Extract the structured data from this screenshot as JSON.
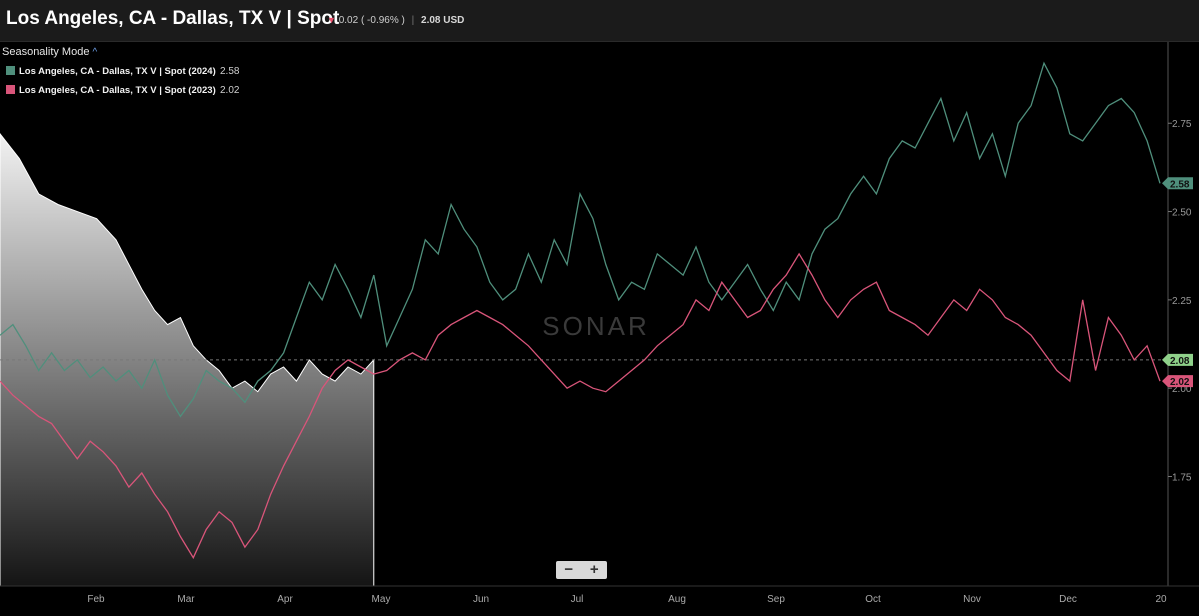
{
  "header": {
    "title": "Los Angeles, CA - Dallas, TX V | Spot",
    "change_text": "0.02 ( -0.96% )",
    "price_text": "2.08 USD"
  },
  "legend": {
    "mode_label": "Seasonality Mode",
    "items": [
      {
        "label": "Los Angeles, CA - Dallas, TX V | Spot (2024)",
        "value": "2.58",
        "color": "#4f8f7c"
      },
      {
        "label": "Los Angeles, CA - Dallas, TX V | Spot (2023)",
        "value": "2.02",
        "color": "#d9557a"
      }
    ]
  },
  "watermark": "SONAR",
  "zoom": {
    "minus": "−",
    "plus": "+"
  },
  "chart_data": {
    "type": "line",
    "x_ticks": [
      "Feb",
      "Mar",
      "Apr",
      "May",
      "Jun",
      "Jul",
      "Aug",
      "Sep",
      "Oct",
      "Nov",
      "Dec",
      "20"
    ],
    "y_ticks": [
      "1.75",
      "2.00",
      "2.25",
      "2.50",
      "2.75"
    ],
    "ylim": [
      1.44,
      2.98
    ],
    "current_line": 2.08,
    "badges": [
      {
        "value": "2.58",
        "color": "#4f8f7c"
      },
      {
        "value": "2.08",
        "color": "#8fd18a"
      },
      {
        "value": "2.02",
        "color": "#d9557a"
      }
    ],
    "series": [
      {
        "name": "Los Angeles, CA - Dallas, TX V | Spot (2024)",
        "color": "#4f8f7c",
        "points": [
          [
            0,
            2.15
          ],
          [
            0.2,
            2.18
          ],
          [
            0.4,
            2.12
          ],
          [
            0.6,
            2.05
          ],
          [
            0.8,
            2.1
          ],
          [
            1.0,
            2.05
          ],
          [
            1.2,
            2.08
          ],
          [
            1.4,
            2.03
          ],
          [
            1.6,
            2.06
          ],
          [
            1.8,
            2.02
          ],
          [
            2.0,
            2.05
          ],
          [
            2.2,
            2.0
          ],
          [
            2.4,
            2.08
          ],
          [
            2.6,
            1.98
          ],
          [
            2.8,
            1.92
          ],
          [
            3.0,
            1.97
          ],
          [
            3.2,
            2.05
          ],
          [
            3.4,
            2.02
          ],
          [
            3.6,
            2.0
          ],
          [
            3.8,
            1.96
          ],
          [
            4.0,
            2.02
          ],
          [
            4.2,
            2.05
          ],
          [
            4.4,
            2.1
          ],
          [
            4.6,
            2.2
          ],
          [
            4.8,
            2.3
          ],
          [
            5.0,
            2.25
          ],
          [
            5.2,
            2.35
          ],
          [
            5.4,
            2.28
          ],
          [
            5.6,
            2.2
          ],
          [
            5.8,
            2.32
          ],
          [
            6.0,
            2.12
          ],
          [
            6.2,
            2.2
          ],
          [
            6.4,
            2.28
          ],
          [
            6.6,
            2.42
          ],
          [
            6.8,
            2.38
          ],
          [
            7.0,
            2.52
          ],
          [
            7.2,
            2.45
          ],
          [
            7.4,
            2.4
          ],
          [
            7.6,
            2.3
          ],
          [
            7.8,
            2.25
          ],
          [
            8.0,
            2.28
          ],
          [
            8.2,
            2.38
          ],
          [
            8.4,
            2.3
          ],
          [
            8.6,
            2.42
          ],
          [
            8.8,
            2.35
          ],
          [
            9.0,
            2.55
          ],
          [
            9.2,
            2.48
          ],
          [
            9.4,
            2.35
          ],
          [
            9.6,
            2.25
          ],
          [
            9.8,
            2.3
          ],
          [
            10.0,
            2.28
          ],
          [
            10.2,
            2.38
          ],
          [
            10.4,
            2.35
          ],
          [
            10.6,
            2.32
          ],
          [
            10.8,
            2.4
          ],
          [
            11.0,
            2.3
          ],
          [
            11.2,
            2.25
          ],
          [
            11.4,
            2.3
          ],
          [
            11.6,
            2.35
          ],
          [
            11.8,
            2.28
          ],
          [
            12.0,
            2.22
          ],
          [
            12.2,
            2.3
          ],
          [
            12.4,
            2.25
          ],
          [
            12.6,
            2.38
          ],
          [
            12.8,
            2.45
          ],
          [
            13.0,
            2.48
          ],
          [
            13.2,
            2.55
          ],
          [
            13.4,
            2.6
          ],
          [
            13.6,
            2.55
          ],
          [
            13.8,
            2.65
          ],
          [
            14.0,
            2.7
          ],
          [
            14.2,
            2.68
          ],
          [
            14.4,
            2.75
          ],
          [
            14.6,
            2.82
          ],
          [
            14.8,
            2.7
          ],
          [
            15.0,
            2.78
          ],
          [
            15.2,
            2.65
          ],
          [
            15.4,
            2.72
          ],
          [
            15.6,
            2.6
          ],
          [
            15.8,
            2.75
          ],
          [
            16.0,
            2.8
          ],
          [
            16.2,
            2.92
          ],
          [
            16.4,
            2.85
          ],
          [
            16.6,
            2.72
          ],
          [
            16.8,
            2.7
          ],
          [
            17.0,
            2.75
          ],
          [
            17.2,
            2.8
          ],
          [
            17.4,
            2.82
          ],
          [
            17.6,
            2.78
          ],
          [
            17.8,
            2.7
          ],
          [
            18.0,
            2.58
          ]
        ]
      },
      {
        "name": "Los Angeles, CA - Dallas, TX V | Spot (2023)",
        "color": "#d9557a",
        "points": [
          [
            0,
            2.02
          ],
          [
            0.2,
            1.98
          ],
          [
            0.4,
            1.95
          ],
          [
            0.6,
            1.92
          ],
          [
            0.8,
            1.9
          ],
          [
            1.0,
            1.85
          ],
          [
            1.2,
            1.8
          ],
          [
            1.4,
            1.85
          ],
          [
            1.6,
            1.82
          ],
          [
            1.8,
            1.78
          ],
          [
            2.0,
            1.72
          ],
          [
            2.2,
            1.76
          ],
          [
            2.4,
            1.7
          ],
          [
            2.6,
            1.65
          ],
          [
            2.8,
            1.58
          ],
          [
            3.0,
            1.52
          ],
          [
            3.2,
            1.6
          ],
          [
            3.4,
            1.65
          ],
          [
            3.6,
            1.62
          ],
          [
            3.8,
            1.55
          ],
          [
            4.0,
            1.6
          ],
          [
            4.2,
            1.7
          ],
          [
            4.4,
            1.78
          ],
          [
            4.6,
            1.85
          ],
          [
            4.8,
            1.92
          ],
          [
            5.0,
            2.0
          ],
          [
            5.2,
            2.05
          ],
          [
            5.4,
            2.08
          ],
          [
            5.6,
            2.06
          ],
          [
            5.8,
            2.04
          ],
          [
            6.0,
            2.05
          ],
          [
            6.2,
            2.08
          ],
          [
            6.4,
            2.1
          ],
          [
            6.6,
            2.08
          ],
          [
            6.8,
            2.15
          ],
          [
            7.0,
            2.18
          ],
          [
            7.2,
            2.2
          ],
          [
            7.4,
            2.22
          ],
          [
            7.6,
            2.2
          ],
          [
            7.8,
            2.18
          ],
          [
            8.0,
            2.15
          ],
          [
            8.2,
            2.12
          ],
          [
            8.4,
            2.08
          ],
          [
            8.6,
            2.04
          ],
          [
            8.8,
            2.0
          ],
          [
            9.0,
            2.02
          ],
          [
            9.2,
            2.0
          ],
          [
            9.4,
            1.99
          ],
          [
            9.6,
            2.02
          ],
          [
            9.8,
            2.05
          ],
          [
            10.0,
            2.08
          ],
          [
            10.2,
            2.12
          ],
          [
            10.4,
            2.15
          ],
          [
            10.6,
            2.18
          ],
          [
            10.8,
            2.25
          ],
          [
            11.0,
            2.22
          ],
          [
            11.2,
            2.3
          ],
          [
            11.4,
            2.25
          ],
          [
            11.6,
            2.2
          ],
          [
            11.8,
            2.22
          ],
          [
            12.0,
            2.28
          ],
          [
            12.2,
            2.32
          ],
          [
            12.4,
            2.38
          ],
          [
            12.6,
            2.32
          ],
          [
            12.8,
            2.25
          ],
          [
            13.0,
            2.2
          ],
          [
            13.2,
            2.25
          ],
          [
            13.4,
            2.28
          ],
          [
            13.6,
            2.3
          ],
          [
            13.8,
            2.22
          ],
          [
            14.0,
            2.2
          ],
          [
            14.2,
            2.18
          ],
          [
            14.4,
            2.15
          ],
          [
            14.6,
            2.2
          ],
          [
            14.8,
            2.25
          ],
          [
            15.0,
            2.22
          ],
          [
            15.2,
            2.28
          ],
          [
            15.4,
            2.25
          ],
          [
            15.6,
            2.2
          ],
          [
            15.8,
            2.18
          ],
          [
            16.0,
            2.15
          ],
          [
            16.2,
            2.1
          ],
          [
            16.4,
            2.05
          ],
          [
            16.6,
            2.02
          ],
          [
            16.8,
            2.25
          ],
          [
            17.0,
            2.05
          ],
          [
            17.2,
            2.2
          ],
          [
            17.4,
            2.15
          ],
          [
            17.6,
            2.08
          ],
          [
            17.8,
            2.12
          ],
          [
            18.0,
            2.02
          ]
        ]
      }
    ]
  }
}
